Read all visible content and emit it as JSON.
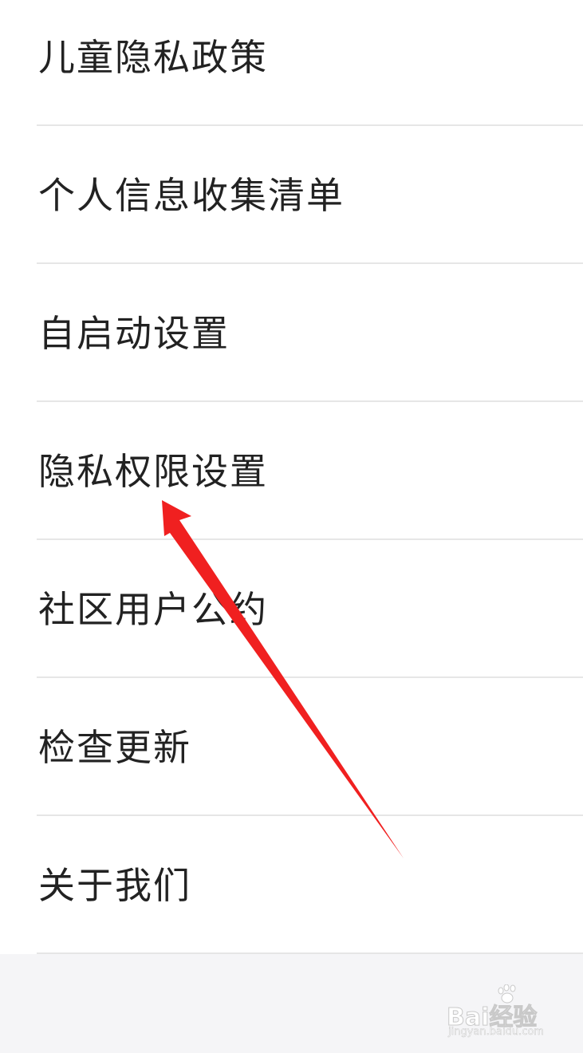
{
  "menu": {
    "items": [
      {
        "label": "儿童隐私政策"
      },
      {
        "label": "个人信息收集清单"
      },
      {
        "label": "自启动设置"
      },
      {
        "label": "隐私权限设置"
      },
      {
        "label": "社区用户公约"
      },
      {
        "label": "检查更新"
      },
      {
        "label": "关于我们"
      }
    ]
  },
  "annotation": {
    "arrow_color": "#f02020",
    "arrow_icon": "red-arrow-icon"
  },
  "watermark": {
    "brand": "Bai经验",
    "url": "jingyan.baidu.com"
  }
}
